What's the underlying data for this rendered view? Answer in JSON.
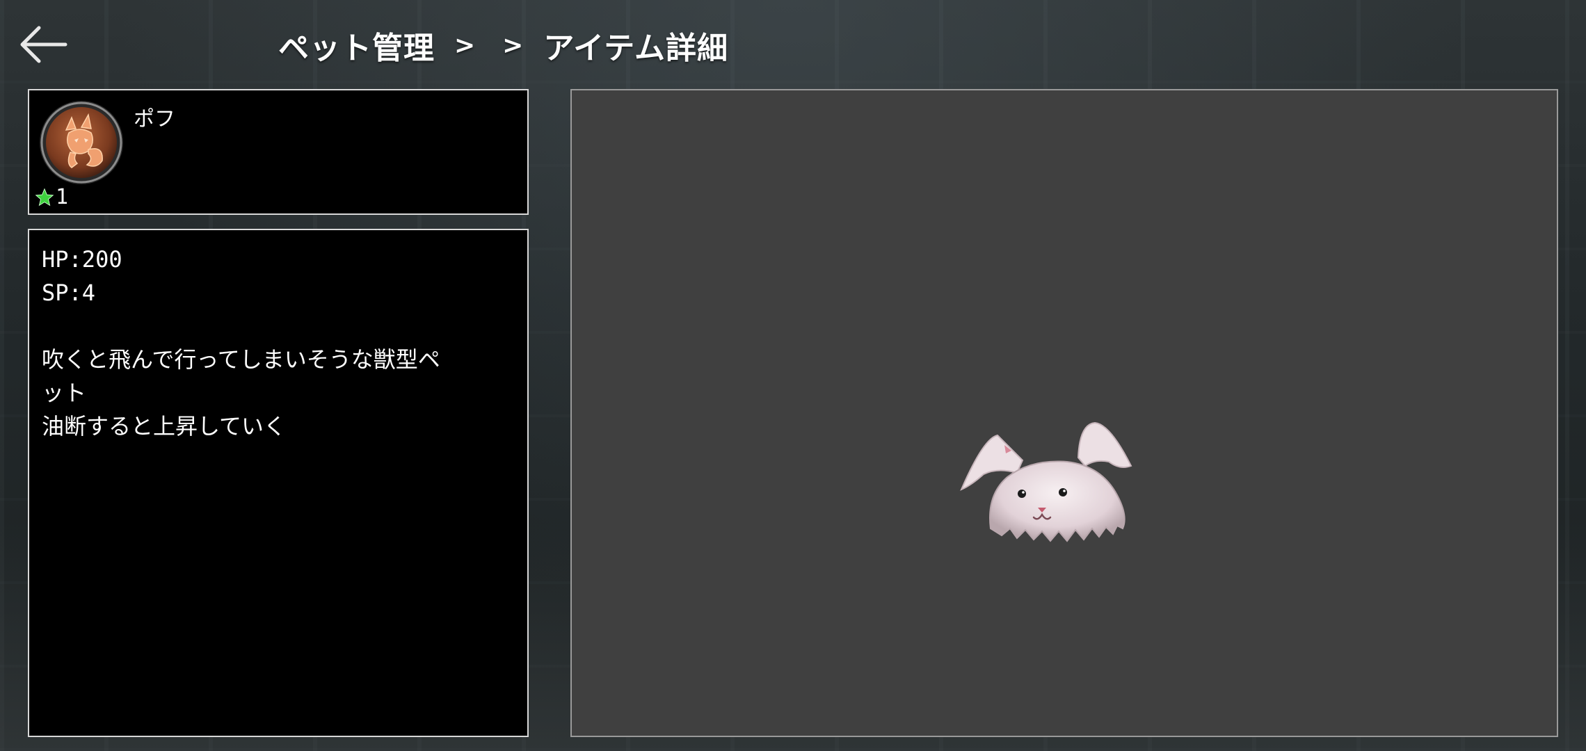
{
  "header": {
    "back_icon": "arrow-left-icon",
    "breadcrumb": {
      "first": "ペット管理",
      "sep1": ">",
      "sep2": ">",
      "current": "アイテム詳細"
    }
  },
  "pet": {
    "name": "ポフ",
    "emblem_icon": "fox-emblem-icon",
    "rank": "1",
    "rank_icon": "star-icon",
    "rank_color": "#3fd13f"
  },
  "details": {
    "hp": "HP:200",
    "sp": "SP:4",
    "description_lines": [
      "吹くと飛んで行ってしまいそうな獣型ペ",
      "ット",
      "油断すると上昇していく"
    ]
  },
  "preview": {
    "model": "pet-model-poff"
  }
}
